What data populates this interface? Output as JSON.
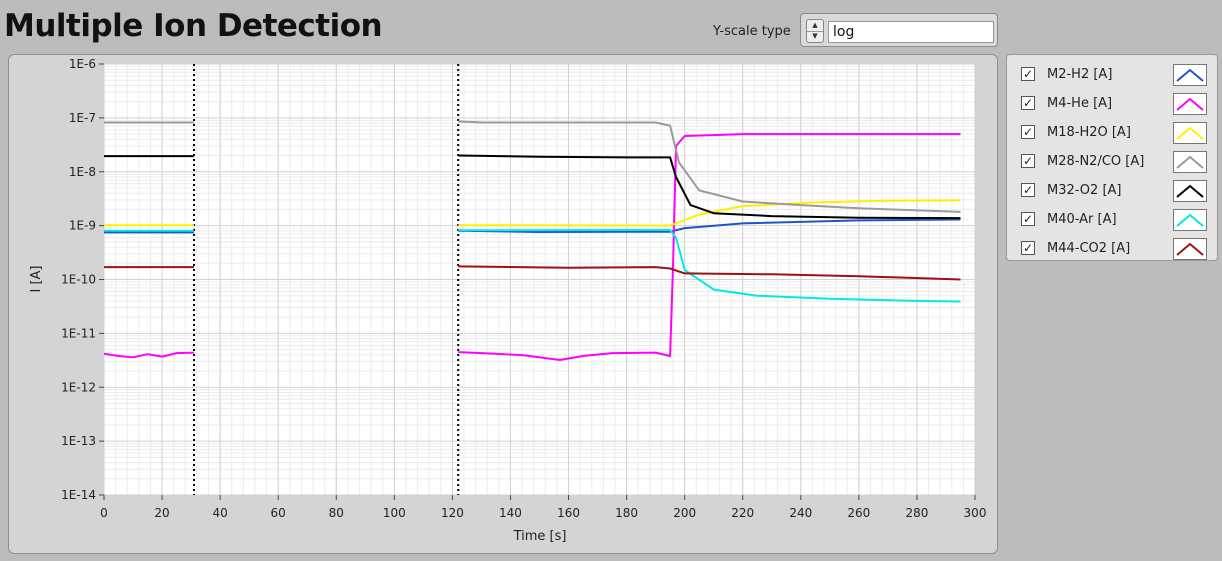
{
  "title": "Multiple Ion Detection",
  "yscale": {
    "label": "Y-scale type",
    "value": "log"
  },
  "chart_data": {
    "type": "line",
    "title": "",
    "xlabel": "Time [s]",
    "ylabel": "I [A]",
    "xlim": [
      0,
      300
    ],
    "ylim": [
      1e-14,
      1e-06
    ],
    "yscale": "log",
    "xticks": [
      0,
      20,
      40,
      60,
      80,
      100,
      120,
      140,
      160,
      180,
      200,
      220,
      240,
      260,
      280,
      300
    ],
    "yticks": [
      {
        "v": 1e-06,
        "label": "1E-6"
      },
      {
        "v": 1e-07,
        "label": "1E-7"
      },
      {
        "v": 1e-08,
        "label": "1E-8"
      },
      {
        "v": 1e-09,
        "label": "1E-9"
      },
      {
        "v": 1e-10,
        "label": "1E-10"
      },
      {
        "v": 1e-11,
        "label": "1E-11"
      },
      {
        "v": 1e-12,
        "label": "1E-12"
      },
      {
        "v": 1e-13,
        "label": "1E-13"
      },
      {
        "v": 1e-14,
        "label": "1E-14"
      }
    ],
    "grid": true,
    "markers": [
      31,
      122
    ],
    "legend_position": "right",
    "series": [
      {
        "name": "M2-H2 [A]",
        "color": "#1f55c8",
        "segments": [
          [
            [
              0,
              7.5e-10
            ],
            [
              31,
              7.5e-10
            ]
          ],
          [
            [
              122,
              8e-10
            ],
            [
              150,
              7.6e-10
            ],
            [
              195,
              7.7e-10
            ],
            [
              200,
              9e-10
            ],
            [
              220,
              1.1e-09
            ],
            [
              260,
              1.25e-09
            ],
            [
              295,
              1.3e-09
            ]
          ]
        ]
      },
      {
        "name": "M4-He [A]",
        "color": "#ff00ff",
        "segments": [
          [
            [
              0,
              4.2e-12
            ],
            [
              5,
              3.8e-12
            ],
            [
              10,
              3.6e-12
            ],
            [
              15,
              4.1e-12
            ],
            [
              20,
              3.7e-12
            ],
            [
              25,
              4.3e-12
            ],
            [
              31,
              4.4e-12
            ]
          ],
          [
            [
              122,
              4.5e-12
            ],
            [
              135,
              4.2e-12
            ],
            [
              145,
              3.9e-12
            ],
            [
              157,
              3.2e-12
            ],
            [
              165,
              3.8e-12
            ],
            [
              175,
              4.3e-12
            ],
            [
              190,
              4.4e-12
            ],
            [
              195,
              3.8e-12
            ],
            [
              196,
              2e-10
            ],
            [
              197,
              3e-08
            ],
            [
              200,
              4.6e-08
            ],
            [
              220,
              5e-08
            ],
            [
              295,
              5e-08
            ]
          ]
        ]
      },
      {
        "name": "M18-H2O [A]",
        "color": "#ffee00",
        "segments": [
          [
            [
              0,
              1.02e-09
            ],
            [
              31,
              1.02e-09
            ]
          ],
          [
            [
              122,
              1.02e-09
            ],
            [
              195,
              1e-09
            ],
            [
              205,
              1.6e-09
            ],
            [
              220,
              2.3e-09
            ],
            [
              245,
              2.7e-09
            ],
            [
              270,
              2.9e-09
            ],
            [
              295,
              2.95e-09
            ]
          ]
        ]
      },
      {
        "name": "M28-N2/CO [A]",
        "color": "#9a9a9a",
        "segments": [
          [
            [
              0,
              8.2e-08
            ],
            [
              31,
              8.2e-08
            ]
          ],
          [
            [
              122,
              8.6e-08
            ],
            [
              130,
              8.2e-08
            ],
            [
              190,
              8.2e-08
            ],
            [
              195,
              7.2e-08
            ],
            [
              198,
              1.5e-08
            ],
            [
              205,
              4.5e-09
            ],
            [
              220,
              2.8e-09
            ],
            [
              240,
              2.4e-09
            ],
            [
              260,
              2.1e-09
            ],
            [
              295,
              1.8e-09
            ]
          ]
        ]
      },
      {
        "name": "M32-O2 [A]",
        "color": "#000000",
        "segments": [
          [
            [
              0,
              1.95e-08
            ],
            [
              31,
              1.95e-08
            ]
          ],
          [
            [
              122,
              2e-08
            ],
            [
              150,
              1.9e-08
            ],
            [
              180,
              1.85e-08
            ],
            [
              195,
              1.85e-08
            ],
            [
              197,
              8e-09
            ],
            [
              202,
              2.4e-09
            ],
            [
              210,
              1.7e-09
            ],
            [
              230,
              1.5e-09
            ],
            [
              260,
              1.4e-09
            ],
            [
              295,
              1.38e-09
            ]
          ]
        ]
      },
      {
        "name": "M40-Ar [A]",
        "color": "#00e8e8",
        "segments": [
          [
            [
              0,
              8e-10
            ],
            [
              31,
              8e-10
            ]
          ],
          [
            [
              122,
              8.2e-10
            ],
            [
              195,
              8.3e-10
            ],
            [
              197,
              6e-10
            ],
            [
              200,
              1.5e-10
            ],
            [
              210,
              6.5e-11
            ],
            [
              225,
              5e-11
            ],
            [
              250,
              4.4e-11
            ],
            [
              280,
              4e-11
            ],
            [
              295,
              3.9e-11
            ]
          ]
        ]
      },
      {
        "name": "M44-CO2 [A]",
        "color": "#a01010",
        "segments": [
          [
            [
              0,
              1.7e-10
            ],
            [
              31,
              1.7e-10
            ]
          ],
          [
            [
              122,
              1.75e-10
            ],
            [
              160,
              1.65e-10
            ],
            [
              190,
              1.7e-10
            ],
            [
              195,
              1.6e-10
            ],
            [
              200,
              1.3e-10
            ],
            [
              230,
              1.25e-10
            ],
            [
              260,
              1.15e-10
            ],
            [
              295,
              1e-10
            ]
          ]
        ]
      }
    ]
  }
}
